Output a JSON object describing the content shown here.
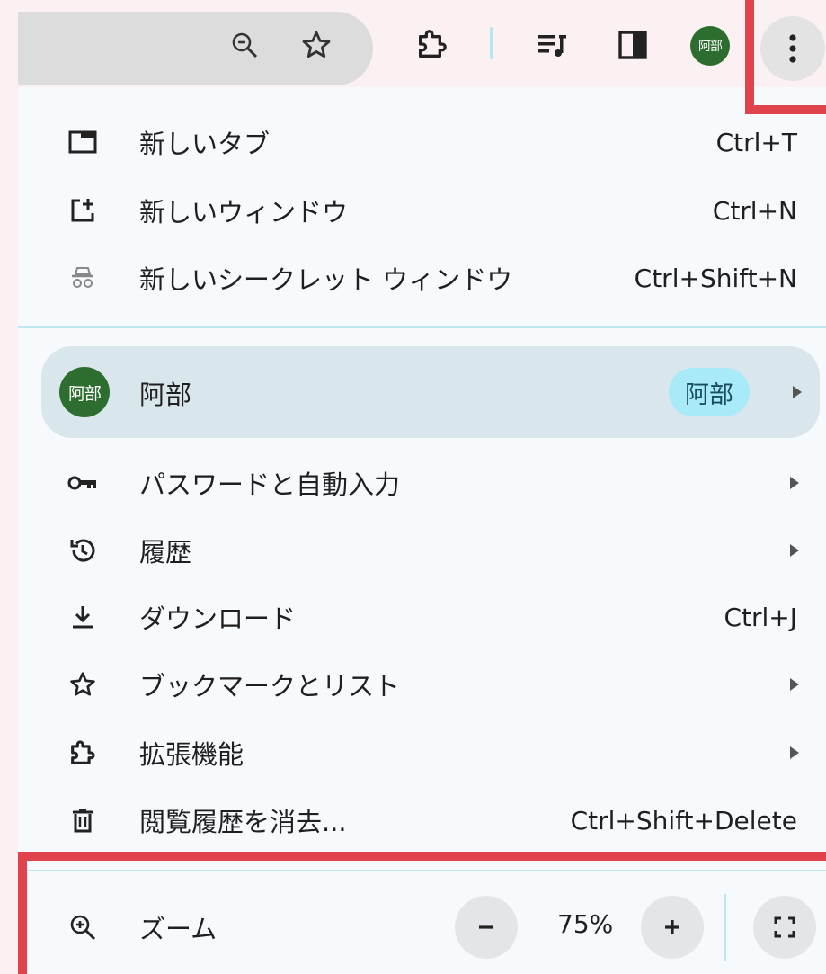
{
  "toolbar": {
    "avatar_text": "阿部",
    "icons": [
      "zoom-out-icon",
      "star-icon",
      "extensions-icon",
      "reading-list-icon",
      "side-panel-icon",
      "kebab-menu-icon"
    ]
  },
  "menu": {
    "new_tab": {
      "label": "新しいタブ",
      "shortcut": "Ctrl+T",
      "icon": "new-tab-icon"
    },
    "new_window": {
      "label": "新しいウィンドウ",
      "shortcut": "Ctrl+N",
      "icon": "new-window-icon"
    },
    "incognito": {
      "label": "新しいシークレット ウィンドウ",
      "shortcut": "Ctrl+Shift+N",
      "icon": "incognito-icon"
    },
    "profile": {
      "avatar_text": "阿部",
      "label": "阿部",
      "chip": "阿部"
    },
    "passwords": {
      "label": "パスワードと自動入力",
      "icon": "key-icon"
    },
    "history": {
      "label": "履歴",
      "icon": "history-icon"
    },
    "downloads": {
      "label": "ダウンロード",
      "shortcut": "Ctrl+J",
      "icon": "download-icon"
    },
    "bookmarks": {
      "label": "ブックマークとリスト",
      "icon": "star-icon"
    },
    "extensions": {
      "label": "拡張機能",
      "icon": "extensions-icon"
    },
    "clear_data": {
      "label": "閲覧履歴を消去...",
      "shortcut": "Ctrl+Shift+Delete",
      "icon": "trash-icon"
    },
    "zoom": {
      "label": "ズーム",
      "value": "75%",
      "icon": "zoom-in-icon"
    }
  },
  "colors": {
    "highlight": "#e0434b",
    "menu_bg": "#f6fafc",
    "profile_row_bg": "#d9e6ec",
    "avatar_bg": "#2d6d2f",
    "chip_bg": "#a8eaf8"
  }
}
